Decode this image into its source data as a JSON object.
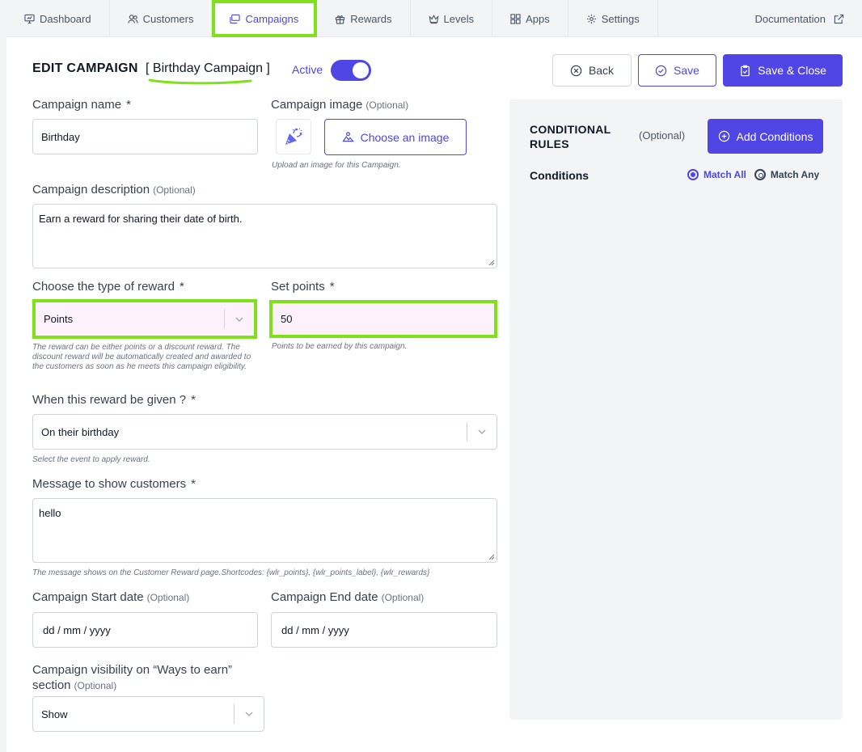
{
  "nav": {
    "items": [
      {
        "label": "Dashboard",
        "icon": "dashboard-icon"
      },
      {
        "label": "Customers",
        "icon": "users-icon"
      },
      {
        "label": "Campaigns",
        "icon": "campaigns-icon"
      },
      {
        "label": "Rewards",
        "icon": "gift-icon"
      },
      {
        "label": "Levels",
        "icon": "crown-icon"
      },
      {
        "label": "Apps",
        "icon": "apps-icon"
      },
      {
        "label": "Settings",
        "icon": "gear-icon"
      }
    ],
    "active": "Campaigns",
    "documentation": "Documentation"
  },
  "header": {
    "title": "EDIT CAMPAIGN",
    "campaign_name_display": "[ Birthday Campaign ]",
    "active_label": "Active",
    "active": true,
    "back_label": "Back",
    "save_label": "Save",
    "save_close_label": "Save & Close"
  },
  "form": {
    "campaign_name": {
      "label": "Campaign name",
      "required": "*",
      "value": "Birthday"
    },
    "campaign_image": {
      "label": "Campaign image",
      "optional": "(Optional)",
      "button": "Choose an image",
      "hint": "Upload an image for this Campaign."
    },
    "description": {
      "label": "Campaign description",
      "optional": "(Optional)",
      "value": "Earn a reward for sharing their date of birth."
    },
    "reward_type": {
      "label": "Choose the type of reward",
      "required": "*",
      "value": "Points",
      "hint": "The reward can be either points or a discount reward. The discount reward will be automatically created and awarded to the customers as soon as he meets this campaign eligibility."
    },
    "points": {
      "label": "Set points",
      "required": "*",
      "value": "50",
      "hint": "Points to be earned by this campaign."
    },
    "when": {
      "label": "When this reward be given ?",
      "required": "*",
      "value": "On their birthday",
      "hint": "Select the event to apply reward."
    },
    "message": {
      "label": "Message to show customers",
      "required": "*",
      "value": "hello",
      "hint": "The message shows on the Customer Reward page.Shortcodes: {wlr_points}, {wlr_points_label}, {wlr_rewards}"
    },
    "start_date": {
      "label": "Campaign Start date",
      "optional": "(Optional)",
      "placeholder": "dd / mm / yyyy"
    },
    "end_date": {
      "label": "Campaign End date",
      "optional": "(Optional)",
      "placeholder": "dd / mm / yyyy"
    },
    "visibility": {
      "label_line1": "Campaign visibility on “Ways to earn”",
      "label_line2": "section",
      "optional": "(Optional)",
      "value": "Show"
    }
  },
  "rules": {
    "title_line1": "CONDITIONAL",
    "title_line2": "RULES",
    "optional": "(Optional)",
    "add_label": "Add Conditions",
    "conditions_label": "Conditions",
    "match_all": "Match All",
    "match_any": "Match Any",
    "selected": "Match All"
  },
  "colors": {
    "accent": "#4f46e5",
    "highlight": "#7ee11a"
  }
}
